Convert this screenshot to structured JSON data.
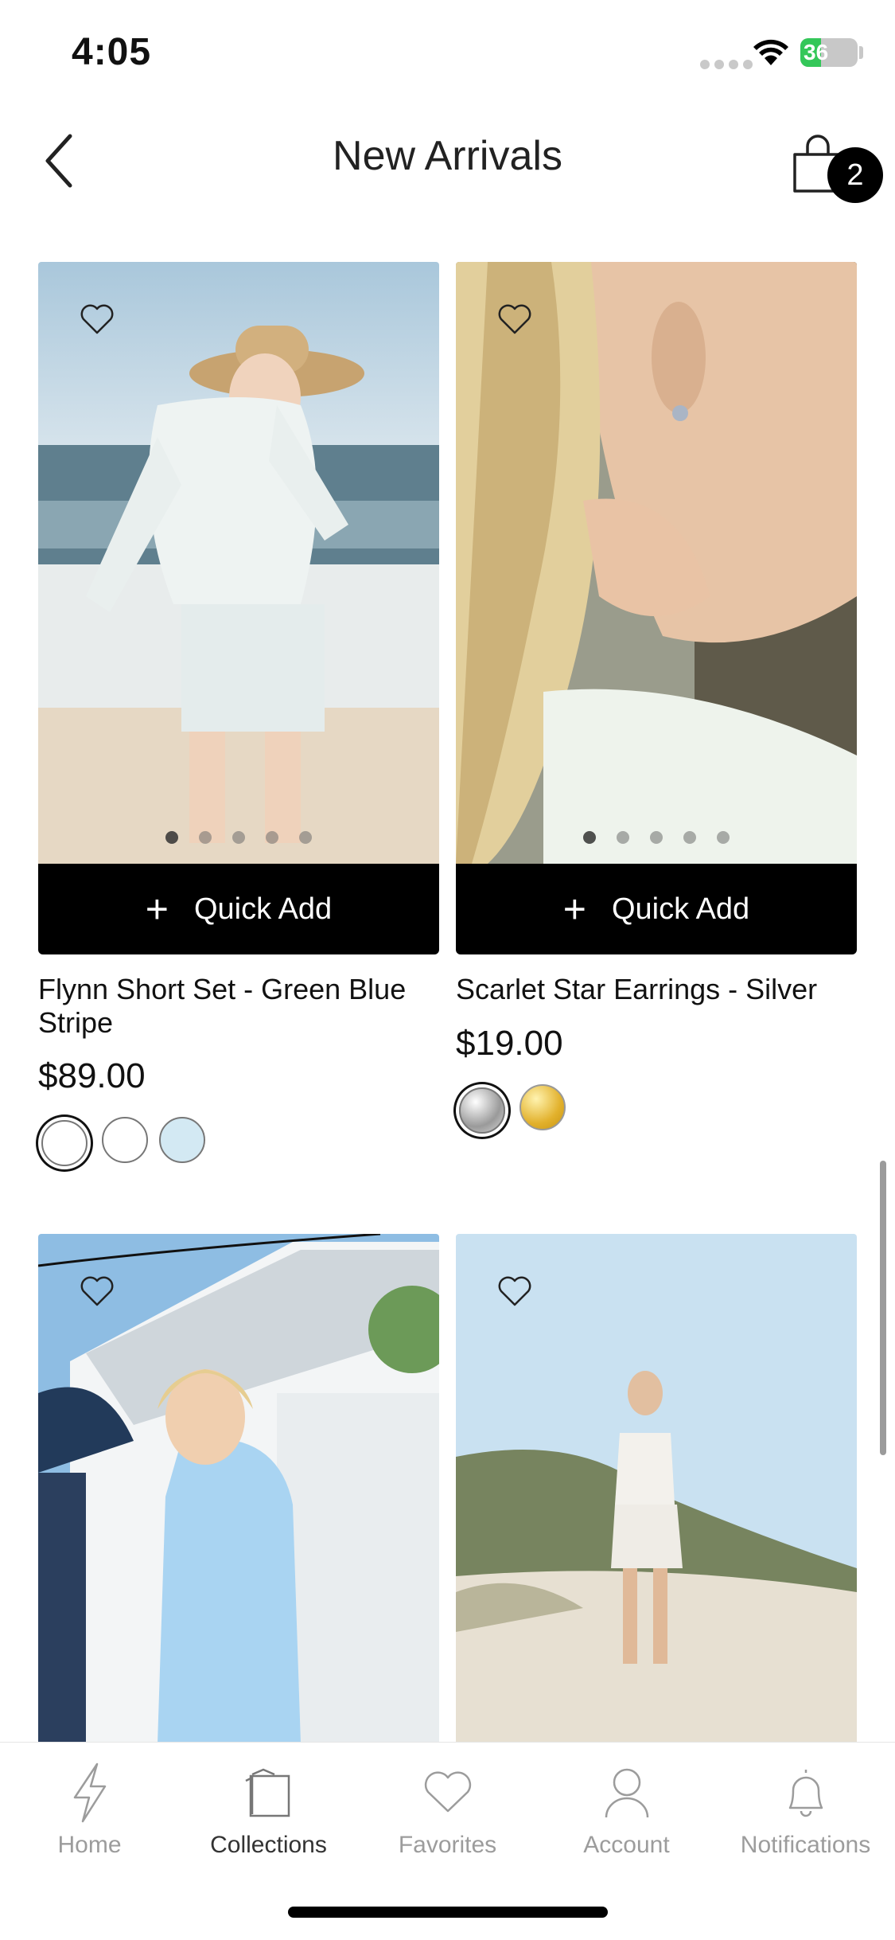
{
  "status_bar": {
    "time": "4:05",
    "battery": "36",
    "battery_level": 0.36
  },
  "header": {
    "title": "New Arrivals",
    "cart_count": "2"
  },
  "products": [
    {
      "name": "Flynn Short Set - Green Blue Stripe",
      "price": "$89.00",
      "quick_add": "Quick Add",
      "image_slides": 5,
      "active_slide": 1,
      "swatches": [
        "#ffffff",
        "#ffffff",
        "#d3e9f3"
      ],
      "selected_swatch": 1
    },
    {
      "name": "Scarlet Star Earrings - Silver",
      "price": "$19.00",
      "quick_add": "Quick Add",
      "image_slides": 5,
      "active_slide": 1,
      "swatches": [
        "silver",
        "gold"
      ],
      "selected_swatch": 1
    },
    {
      "name": "",
      "price": ""
    },
    {
      "name": "",
      "price": ""
    }
  ],
  "tabs": [
    {
      "label": "Home",
      "icon": "bolt-icon",
      "active": false
    },
    {
      "label": "Collections",
      "icon": "collections-icon",
      "active": true
    },
    {
      "label": "Favorites",
      "icon": "heart-icon",
      "active": false
    },
    {
      "label": "Account",
      "icon": "person-icon",
      "active": false
    },
    {
      "label": "Notifications",
      "icon": "bell-icon",
      "active": false
    }
  ]
}
